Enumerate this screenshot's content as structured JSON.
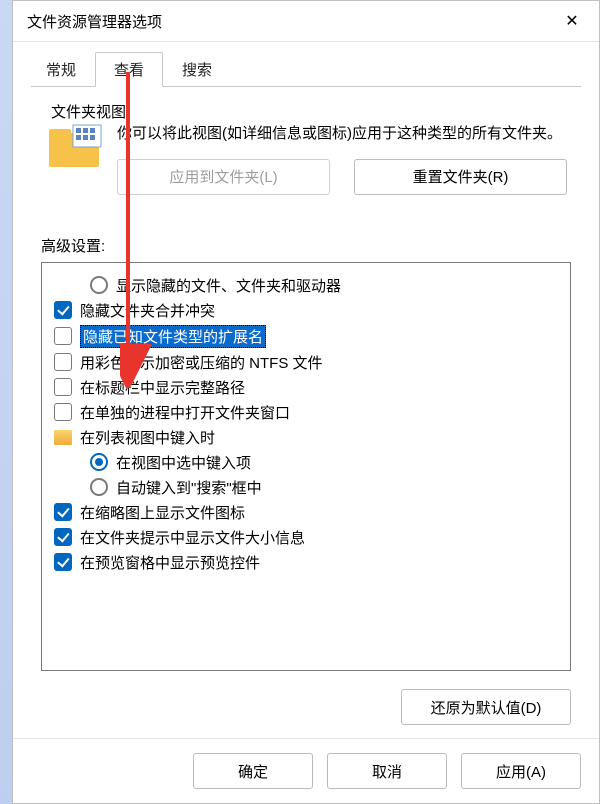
{
  "title": "文件资源管理器选项",
  "tabs": {
    "general": "常规",
    "view": "查看",
    "search": "搜索"
  },
  "folderView": {
    "group_label": "文件夹视图",
    "desc": "你可以将此视图(如详细信息或图标)应用于这种类型的所有文件夹。",
    "apply_btn": "应用到文件夹(L)",
    "reset_btn": "重置文件夹(R)"
  },
  "advanced_label": "高级设置:",
  "items": [
    {
      "type": "radio",
      "indent": 1,
      "checked": false,
      "label": "显示隐藏的文件、文件夹和驱动器"
    },
    {
      "type": "check",
      "indent": 0,
      "checked": true,
      "label": "隐藏文件夹合并冲突"
    },
    {
      "type": "check",
      "indent": 0,
      "checked": false,
      "label": "隐藏已知文件类型的扩展名",
      "highlight": true
    },
    {
      "type": "check",
      "indent": 0,
      "checked": false,
      "label": "用彩色显示加密或压缩的 NTFS 文件"
    },
    {
      "type": "check",
      "indent": 0,
      "checked": false,
      "label": "在标题栏中显示完整路径"
    },
    {
      "type": "check",
      "indent": 0,
      "checked": false,
      "label": "在单独的进程中打开文件夹窗口"
    },
    {
      "type": "folder",
      "indent": 0,
      "label": "在列表视图中键入时"
    },
    {
      "type": "radio",
      "indent": 1,
      "checked": true,
      "label": "在视图中选中键入项"
    },
    {
      "type": "radio",
      "indent": 1,
      "checked": false,
      "label": "自动键入到\"搜索\"框中"
    },
    {
      "type": "check",
      "indent": 0,
      "checked": true,
      "label": "在缩略图上显示文件图标"
    },
    {
      "type": "check",
      "indent": 0,
      "checked": true,
      "label": "在文件夹提示中显示文件大小信息"
    },
    {
      "type": "check",
      "indent": 0,
      "checked": true,
      "label": "在预览窗格中显示预览控件"
    }
  ],
  "restore_defaults": "还原为默认值(D)",
  "footer": {
    "ok": "确定",
    "cancel": "取消",
    "apply": "应用(A)"
  }
}
